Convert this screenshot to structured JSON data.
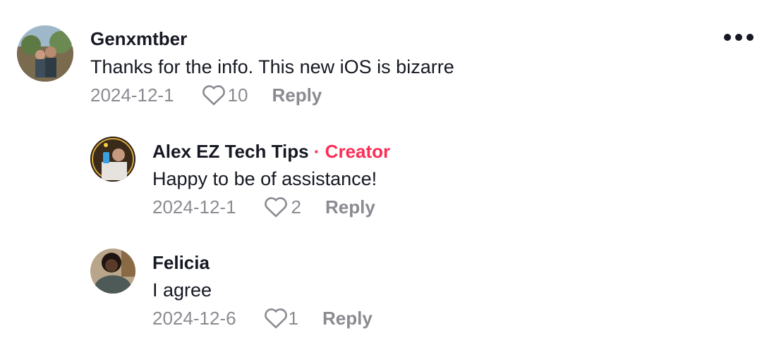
{
  "comments": [
    {
      "author": "Genxmtber",
      "text": "Thanks for the info. This new iOS is bizarre",
      "date": "2024-12-1",
      "likes": "10",
      "reply_label": "Reply",
      "avatar_icon": "user-avatar"
    },
    {
      "author": "Alex EZ Tech Tips",
      "badge": "· Creator",
      "text": "Happy to be of assistance!",
      "date": "2024-12-1",
      "likes": "2",
      "reply_label": "Reply",
      "avatar_icon": "user-avatar"
    },
    {
      "author": "Felicia",
      "text": "I agree",
      "date": "2024-12-6",
      "likes": "1",
      "reply_label": "Reply",
      "avatar_icon": "user-avatar"
    }
  ],
  "more_icon": "more-options-icon",
  "colors": {
    "creator": "#fe2c55",
    "meta": "#8a8b91",
    "text": "#161823"
  }
}
